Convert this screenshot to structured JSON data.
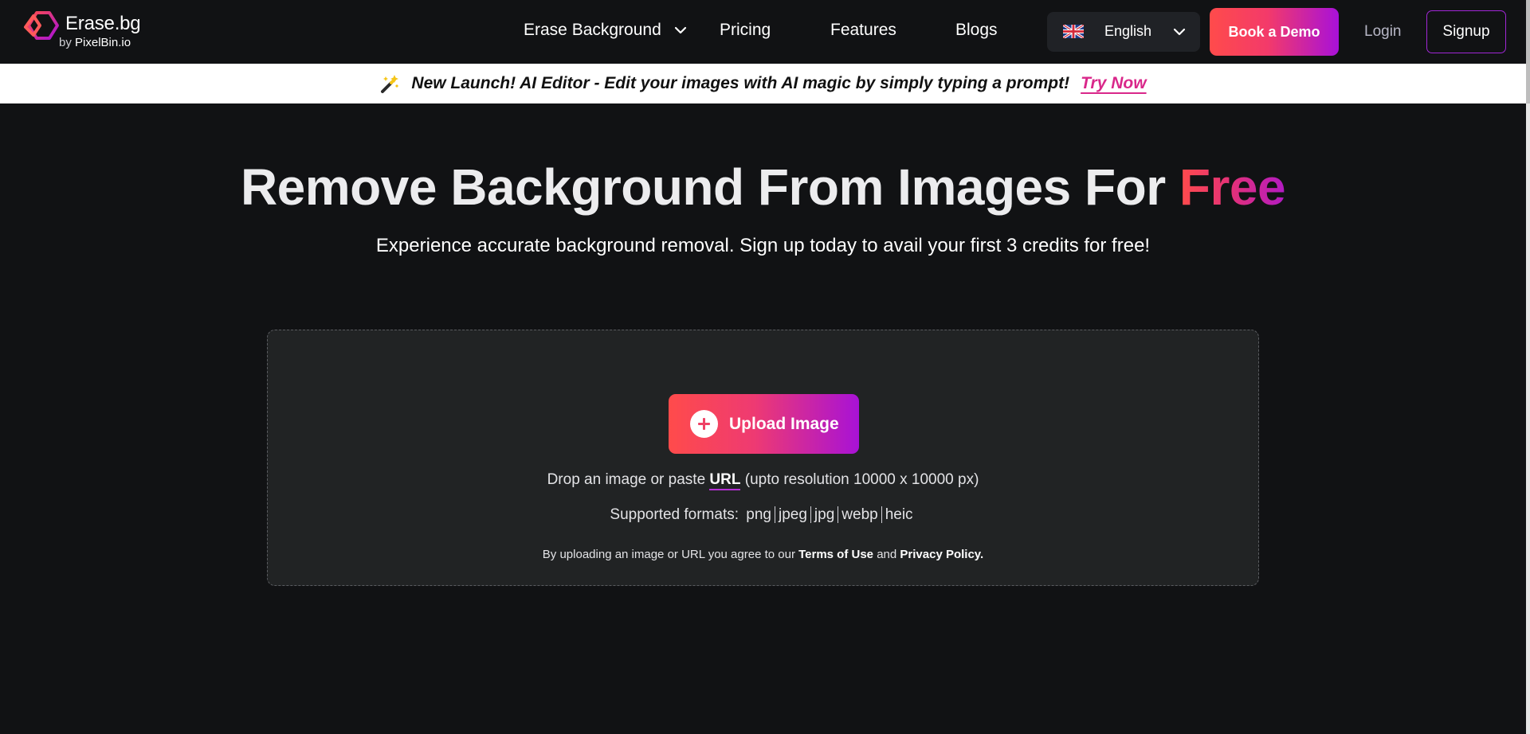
{
  "brand": {
    "name": "Erase.bg",
    "by_label": "by",
    "parent": "PixelBin.io",
    "gradient_start": "#ff4b4b",
    "gradient_end": "#a811d9"
  },
  "nav": {
    "erase_background": "Erase Background",
    "pricing": "Pricing",
    "features": "Features",
    "blogs": "Blogs"
  },
  "language": {
    "selected": "English",
    "flag_icon": "uk-flag-icon"
  },
  "header_actions": {
    "book_demo": "Book a Demo",
    "login": "Login",
    "signup": "Signup"
  },
  "banner": {
    "icon": "magic-wand-icon",
    "text": "New Launch! AI Editor - Edit your images with AI magic by simply typing a prompt!",
    "link": "Try Now"
  },
  "hero": {
    "title_main": "Remove Background From Images For",
    "title_accent": "Free",
    "subtitle": "Experience accurate background removal. Sign up today to avail your first 3 credits for free!"
  },
  "upload": {
    "button_label": "Upload Image",
    "drop_prefix": "Drop an image or paste",
    "drop_url": "URL",
    "drop_suffix": "(upto resolution 10000 x 10000 px)",
    "formats_label": "Supported formats:",
    "formats": [
      "png",
      "jpeg",
      "jpg",
      "webp",
      "heic"
    ],
    "terms_prefix": "By uploading an image or URL you agree to our",
    "terms_link": "Terms of Use",
    "terms_and": "and",
    "privacy_link": "Privacy Policy."
  }
}
